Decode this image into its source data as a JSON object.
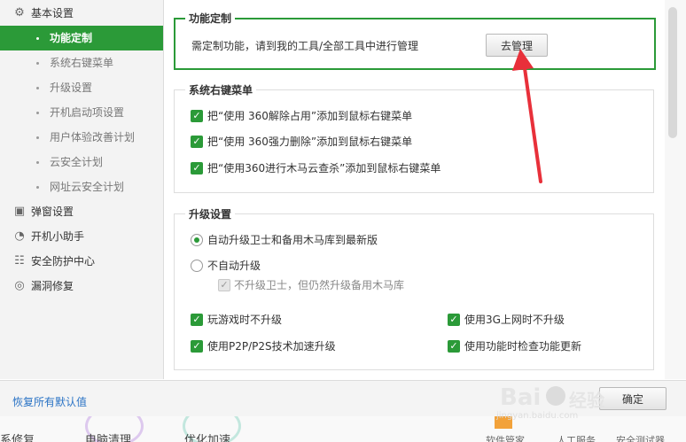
{
  "sidebar": {
    "groups": [
      {
        "label": "基本设置",
        "icon": "gear-icon"
      },
      {
        "label": "弹窗设置",
        "icon": "window-icon"
      },
      {
        "label": "开机小助手",
        "icon": "timer-icon"
      },
      {
        "label": "安全防护中心",
        "icon": "shield-grid-icon"
      },
      {
        "label": "漏洞修复",
        "icon": "patch-icon"
      }
    ],
    "items": [
      {
        "label": "功能定制",
        "active": true
      },
      {
        "label": "系统右键菜单"
      },
      {
        "label": "升级设置"
      },
      {
        "label": "开机启动项设置"
      },
      {
        "label": "用户体验改善计划"
      },
      {
        "label": "云安全计划"
      },
      {
        "label": "网址云安全计划"
      }
    ]
  },
  "custom": {
    "title": "功能定制",
    "desc": "需定制功能，请到我的工具/全部工具中进行管理",
    "button": "去管理"
  },
  "context_menu": {
    "title": "系统右键菜单",
    "options": [
      "把“使用 360解除占用”添加到鼠标右键菜单",
      "把“使用 360强力删除”添加到鼠标右键菜单",
      "把“使用360进行木马云查杀”添加到鼠标右键菜单"
    ]
  },
  "upgrade": {
    "title": "升级设置",
    "auto": "自动升级卫士和备用木马库到最新版",
    "manual": "不自动升级",
    "sub": "不升级卫士，但仍然升级备用木马库",
    "game": "玩游戏时不升级",
    "net3g": "使用3G上网时不升级",
    "p2p": "使用P2P/P2S技术加速升级",
    "check": "使用功能时检查功能更新"
  },
  "footer": {
    "restore": "恢复所有默认值",
    "ok": "确定"
  },
  "background": {
    "labels": [
      "系修复",
      "电脑清理",
      "优化加速",
      "软件管家",
      "人工服务",
      "安全测试器"
    ]
  },
  "watermark": {
    "brand": "Bai",
    "brand2": "经验",
    "url": "jingyan.baidu.com"
  },
  "colors": {
    "accent": "#2b9a38",
    "arrow": "#e8303a",
    "link": "#2a73c5"
  }
}
